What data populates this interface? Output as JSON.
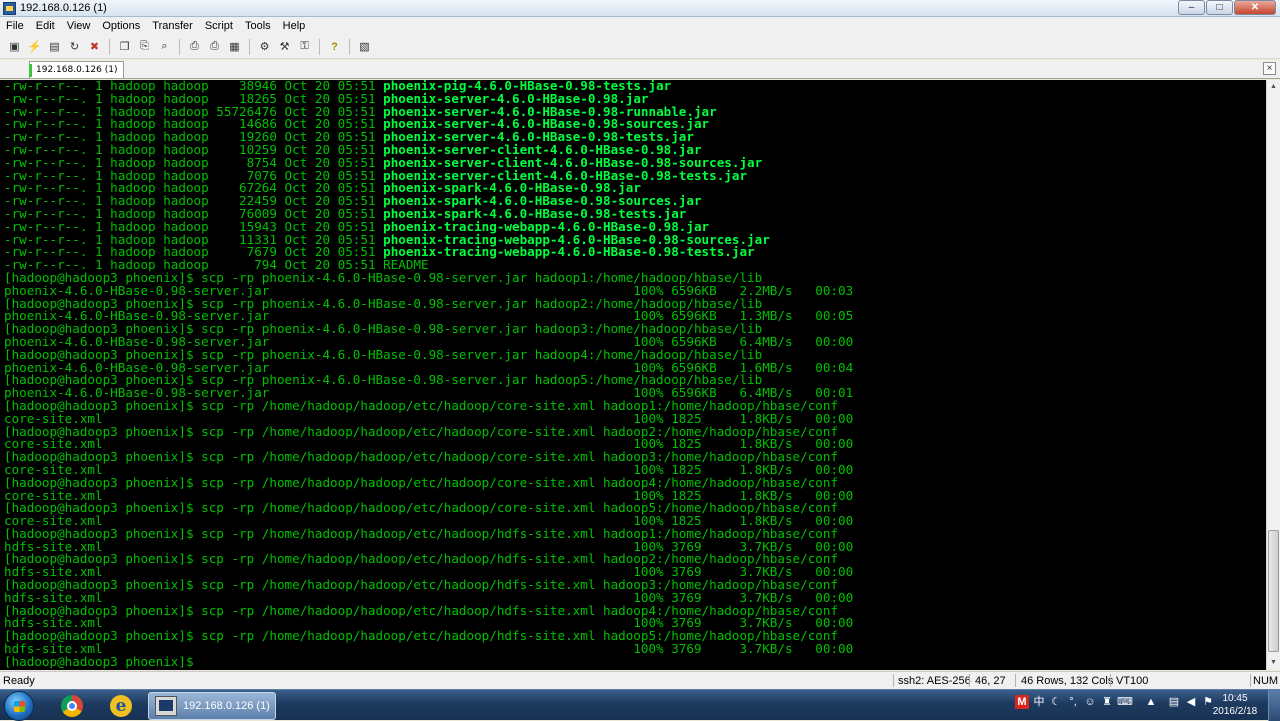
{
  "window": {
    "title": "192.168.0.126 (1)",
    "controls": {
      "minimize": "‒",
      "maximize": "□",
      "close": "✕"
    }
  },
  "menu": [
    "File",
    "Edit",
    "View",
    "Options",
    "Transfer",
    "Script",
    "Tools",
    "Help"
  ],
  "toolbar": {
    "buttons": [
      {
        "name": "connect-icon",
        "glyph": "▣"
      },
      {
        "name": "quick-connect-icon",
        "glyph": "⚡"
      },
      {
        "name": "connect-tab-icon",
        "glyph": "▤"
      },
      {
        "name": "reconnect-icon",
        "glyph": "↻"
      },
      {
        "name": "disconnect-icon",
        "glyph": "✖"
      },
      {
        "name": "copy-icon",
        "glyph": "❐"
      },
      {
        "name": "paste-icon",
        "glyph": "⎘"
      },
      {
        "name": "find-icon",
        "glyph": "⌕"
      },
      {
        "name": "print-setup-icon",
        "glyph": "⎙"
      },
      {
        "name": "print-icon",
        "glyph": "⎙"
      },
      {
        "name": "print-screen-icon",
        "glyph": "▦"
      },
      {
        "name": "session-options-icon",
        "glyph": "⚙"
      },
      {
        "name": "global-options-icon",
        "glyph": "⚒"
      },
      {
        "name": "keymap-icon",
        "glyph": "⚿"
      },
      {
        "name": "help-icon",
        "glyph": "?"
      },
      {
        "name": "sftp-icon",
        "glyph": "▧"
      }
    ]
  },
  "tab": {
    "label": "192.168.0.126 (1)",
    "close": "×"
  },
  "terminal": {
    "lines": [
      {
        "text": "-rw-r--r--. 1 hadoop hadoop    38946 Oct 20 05:51 ",
        "jar": "phoenix-pig-4.6.0-HBase-0.98-tests.jar"
      },
      {
        "text": "-rw-r--r--. 1 hadoop hadoop    18265 Oct 20 05:51 ",
        "jar": "phoenix-server-4.6.0-HBase-0.98.jar"
      },
      {
        "text": "-rw-r--r--. 1 hadoop hadoop 55726476 Oct 20 05:51 ",
        "jar": "phoenix-server-4.6.0-HBase-0.98-runnable.jar"
      },
      {
        "text": "-rw-r--r--. 1 hadoop hadoop    14686 Oct 20 05:51 ",
        "jar": "phoenix-server-4.6.0-HBase-0.98-sources.jar"
      },
      {
        "text": "-rw-r--r--. 1 hadoop hadoop    19260 Oct 20 05:51 ",
        "jar": "phoenix-server-4.6.0-HBase-0.98-tests.jar"
      },
      {
        "text": "-rw-r--r--. 1 hadoop hadoop    10259 Oct 20 05:51 ",
        "jar": "phoenix-server-client-4.6.0-HBase-0.98.jar"
      },
      {
        "text": "-rw-r--r--. 1 hadoop hadoop     8754 Oct 20 05:51 ",
        "jar": "phoenix-server-client-4.6.0-HBase-0.98-sources.jar"
      },
      {
        "text": "-rw-r--r--. 1 hadoop hadoop     7076 Oct 20 05:51 ",
        "jar": "phoenix-server-client-4.6.0-HBase-0.98-tests.jar"
      },
      {
        "text": "-rw-r--r--. 1 hadoop hadoop    67264 Oct 20 05:51 ",
        "jar": "phoenix-spark-4.6.0-HBase-0.98.jar"
      },
      {
        "text": "-rw-r--r--. 1 hadoop hadoop    22459 Oct 20 05:51 ",
        "jar": "phoenix-spark-4.6.0-HBase-0.98-sources.jar"
      },
      {
        "text": "-rw-r--r--. 1 hadoop hadoop    76009 Oct 20 05:51 ",
        "jar": "phoenix-spark-4.6.0-HBase-0.98-tests.jar"
      },
      {
        "text": "-rw-r--r--. 1 hadoop hadoop    15943 Oct 20 05:51 ",
        "jar": "phoenix-tracing-webapp-4.6.0-HBase-0.98.jar"
      },
      {
        "text": "-rw-r--r--. 1 hadoop hadoop    11331 Oct 20 05:51 ",
        "jar": "phoenix-tracing-webapp-4.6.0-HBase-0.98-sources.jar"
      },
      {
        "text": "-rw-r--r--. 1 hadoop hadoop     7679 Oct 20 05:51 ",
        "jar": "phoenix-tracing-webapp-4.6.0-HBase-0.98-tests.jar"
      },
      {
        "text": "-rw-r--r--. 1 hadoop hadoop      794 Oct 20 05:51 README",
        "jar": ""
      },
      {
        "text": "[hadoop@hadoop3 phoenix]$ scp -rp phoenix-4.6.0-HBase-0.98-server.jar hadoop1:/home/hadoop/hbase/lib",
        "jar": ""
      },
      {
        "text": "phoenix-4.6.0-HBase-0.98-server.jar                                                100% 6596KB   2.2MB/s   00:03",
        "jar": ""
      },
      {
        "text": "[hadoop@hadoop3 phoenix]$ scp -rp phoenix-4.6.0-HBase-0.98-server.jar hadoop2:/home/hadoop/hbase/lib",
        "jar": ""
      },
      {
        "text": "phoenix-4.6.0-HBase-0.98-server.jar                                                100% 6596KB   1.3MB/s   00:05",
        "jar": ""
      },
      {
        "text": "[hadoop@hadoop3 phoenix]$ scp -rp phoenix-4.6.0-HBase-0.98-server.jar hadoop3:/home/hadoop/hbase/lib",
        "jar": ""
      },
      {
        "text": "phoenix-4.6.0-HBase-0.98-server.jar                                                100% 6596KB   6.4MB/s   00:00",
        "jar": ""
      },
      {
        "text": "[hadoop@hadoop3 phoenix]$ scp -rp phoenix-4.6.0-HBase-0.98-server.jar hadoop4:/home/hadoop/hbase/lib",
        "jar": ""
      },
      {
        "text": "phoenix-4.6.0-HBase-0.98-server.jar                                                100% 6596KB   1.6MB/s   00:04",
        "jar": ""
      },
      {
        "text": "[hadoop@hadoop3 phoenix]$ scp -rp phoenix-4.6.0-HBase-0.98-server.jar hadoop5:/home/hadoop/hbase/lib",
        "jar": ""
      },
      {
        "text": "phoenix-4.6.0-HBase-0.98-server.jar                                                100% 6596KB   6.4MB/s   00:01",
        "jar": ""
      },
      {
        "text": "[hadoop@hadoop3 phoenix]$ scp -rp /home/hadoop/hadoop/etc/hadoop/core-site.xml hadoop1:/home/hadoop/hbase/conf",
        "jar": ""
      },
      {
        "text": "core-site.xml                                                                      100% 1825     1.8KB/s   00:00",
        "jar": ""
      },
      {
        "text": "[hadoop@hadoop3 phoenix]$ scp -rp /home/hadoop/hadoop/etc/hadoop/core-site.xml hadoop2:/home/hadoop/hbase/conf",
        "jar": ""
      },
      {
        "text": "core-site.xml                                                                      100% 1825     1.8KB/s   00:00",
        "jar": ""
      },
      {
        "text": "[hadoop@hadoop3 phoenix]$ scp -rp /home/hadoop/hadoop/etc/hadoop/core-site.xml hadoop3:/home/hadoop/hbase/conf",
        "jar": ""
      },
      {
        "text": "core-site.xml                                                                      100% 1825     1.8KB/s   00:00",
        "jar": ""
      },
      {
        "text": "[hadoop@hadoop3 phoenix]$ scp -rp /home/hadoop/hadoop/etc/hadoop/core-site.xml hadoop4:/home/hadoop/hbase/conf",
        "jar": ""
      },
      {
        "text": "core-site.xml                                                                      100% 1825     1.8KB/s   00:00",
        "jar": ""
      },
      {
        "text": "[hadoop@hadoop3 phoenix]$ scp -rp /home/hadoop/hadoop/etc/hadoop/core-site.xml hadoop5:/home/hadoop/hbase/conf",
        "jar": ""
      },
      {
        "text": "core-site.xml                                                                      100% 1825     1.8KB/s   00:00",
        "jar": ""
      },
      {
        "text": "[hadoop@hadoop3 phoenix]$ scp -rp /home/hadoop/hadoop/etc/hadoop/hdfs-site.xml hadoop1:/home/hadoop/hbase/conf",
        "jar": ""
      },
      {
        "text": "hdfs-site.xml                                                                      100% 3769     3.7KB/s   00:00",
        "jar": ""
      },
      {
        "text": "[hadoop@hadoop3 phoenix]$ scp -rp /home/hadoop/hadoop/etc/hadoop/hdfs-site.xml hadoop2:/home/hadoop/hbase/conf",
        "jar": ""
      },
      {
        "text": "hdfs-site.xml                                                                      100% 3769     3.7KB/s   00:00",
        "jar": ""
      },
      {
        "text": "[hadoop@hadoop3 phoenix]$ scp -rp /home/hadoop/hadoop/etc/hadoop/hdfs-site.xml hadoop3:/home/hadoop/hbase/conf",
        "jar": ""
      },
      {
        "text": "hdfs-site.xml                                                                      100% 3769     3.7KB/s   00:00",
        "jar": ""
      },
      {
        "text": "[hadoop@hadoop3 phoenix]$ scp -rp /home/hadoop/hadoop/etc/hadoop/hdfs-site.xml hadoop4:/home/hadoop/hbase/conf",
        "jar": ""
      },
      {
        "text": "hdfs-site.xml                                                                      100% 3769     3.7KB/s   00:00",
        "jar": ""
      },
      {
        "text": "[hadoop@hadoop3 phoenix]$ scp -rp /home/hadoop/hadoop/etc/hadoop/hdfs-site.xml hadoop5:/home/hadoop/hbase/conf",
        "jar": ""
      },
      {
        "text": "hdfs-site.xml                                                                      100% 3769     3.7KB/s   00:00",
        "jar": ""
      },
      {
        "text": "[hadoop@hadoop3 phoenix]$ ",
        "jar": ""
      }
    ]
  },
  "statusbar": {
    "status": "Ready",
    "cipher": "ssh2: AES-256",
    "cursor": "46,  27",
    "size": "46 Rows, 132 Cols",
    "emulation": "VT100",
    "num": "NUM"
  },
  "taskbar": {
    "task_label": "192.168.0.126 (1)",
    "ime": "M",
    "ime_lang": "中",
    "time": "10:45",
    "date": "2016/2/18"
  }
}
